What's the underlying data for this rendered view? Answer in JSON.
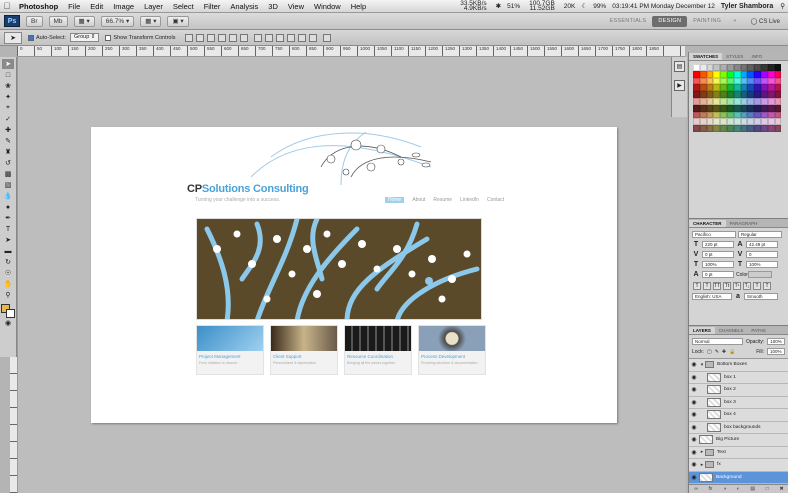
{
  "menubar": {
    "app_name": "Photoshop",
    "items": [
      "File",
      "Edit",
      "Image",
      "Layer",
      "Select",
      "Filter",
      "Analysis",
      "3D",
      "View",
      "Window",
      "Help"
    ],
    "status": {
      "net_up": "33.5KB/s",
      "net_down": "4.9KB/s",
      "battery_pct": "51%",
      "disk_1": "100.7GB",
      "disk_2": "11.52GB",
      "memory": "20K",
      "cpu": "99%",
      "clock": "03:19:41 PM Monday December 12",
      "user": "Tyler Shambora"
    }
  },
  "appbar": {
    "logo": "Ps",
    "zoom": "66.7",
    "workspaces": [
      "ESSENTIALS",
      "DESIGN",
      "PAINTING"
    ],
    "active_workspace": "DESIGN",
    "cs_live": "CS Live"
  },
  "options": {
    "auto_select_label": "Auto-Select:",
    "auto_select_value": "Group",
    "show_transform_label": "Show Transform Controls"
  },
  "ruler": {
    "top_ticks": [
      "0",
      "50",
      "100",
      "150",
      "200",
      "250",
      "300",
      "350",
      "400",
      "450",
      "500",
      "550",
      "600",
      "650",
      "700",
      "750",
      "800",
      "850",
      "900",
      "950",
      "1000",
      "1050",
      "1100",
      "1150",
      "1200",
      "1250",
      "1300",
      "1350",
      "1400",
      "1450",
      "1500",
      "1550",
      "1600",
      "1650",
      "1700",
      "1750",
      "1800",
      "1850"
    ]
  },
  "document": {
    "brand_strong": "CP",
    "brand_rest": "Solutions Consulting",
    "tagline": "Turning your challenge into a success.",
    "nav": [
      "Home",
      "About",
      "Resume",
      "LinkedIn",
      "Contact"
    ],
    "cards": [
      {
        "title": "Project Management",
        "text": "From initiation to closure."
      },
      {
        "title": "Client Support",
        "text": "Personalized & dependable."
      },
      {
        "title": "Resource Coordination",
        "text": "Bringing all the pieces together."
      },
      {
        "title": "Process Development",
        "text": "Providing structure & documentation."
      }
    ]
  },
  "panels": {
    "swatches_tabs": [
      "SWATCHES",
      "STYLES",
      "INFO"
    ],
    "character_tabs": [
      "CHARACTER",
      "PARAGRAPH"
    ],
    "character": {
      "font_family": "Pacifico",
      "font_style": "Regular",
      "size": "220 pt",
      "leading": "42.49 pt",
      "kerning": "0 pt",
      "tracking": "0",
      "vscale": "100%",
      "hscale": "100%",
      "baseline": "0 pt",
      "color_label": "Color:",
      "language": "English: USA",
      "antialias": "Smooth"
    },
    "layers_tabs": [
      "LAYERS",
      "CHANNELS",
      "PATHS"
    ],
    "layers": {
      "blend_mode": "Normal",
      "opacity_label": "Opacity:",
      "opacity": "100%",
      "lock_label": "Lock:",
      "fill_label": "Fill:",
      "fill": "100%",
      "items": [
        {
          "name": "Bottom Boxes",
          "kind": "group",
          "depth": 0
        },
        {
          "name": "box 1",
          "kind": "layer",
          "depth": 1
        },
        {
          "name": "box 2",
          "kind": "layer",
          "depth": 1
        },
        {
          "name": "box 3",
          "kind": "layer",
          "depth": 1
        },
        {
          "name": "box 4",
          "kind": "layer",
          "depth": 1
        },
        {
          "name": "box backgrounds",
          "kind": "layer",
          "depth": 1
        },
        {
          "name": "Big Picture",
          "kind": "layer",
          "depth": 0
        },
        {
          "name": "Text",
          "kind": "group",
          "depth": 0
        },
        {
          "name": "fx",
          "kind": "group",
          "depth": 0
        },
        {
          "name": "Background",
          "kind": "layer",
          "depth": 0,
          "selected": true
        }
      ],
      "footer_icons": [
        "link-icon",
        "fx-icon",
        "mask-icon",
        "adjustment-icon",
        "folder-icon",
        "new-layer-icon",
        "trash-icon"
      ]
    }
  },
  "colors": {
    "brand_blue": "#4aa3d8",
    "banner_brown": "#5a4a2a",
    "selection_blue": "#5d93d8",
    "foreground_swatch": "#e8b94a"
  }
}
